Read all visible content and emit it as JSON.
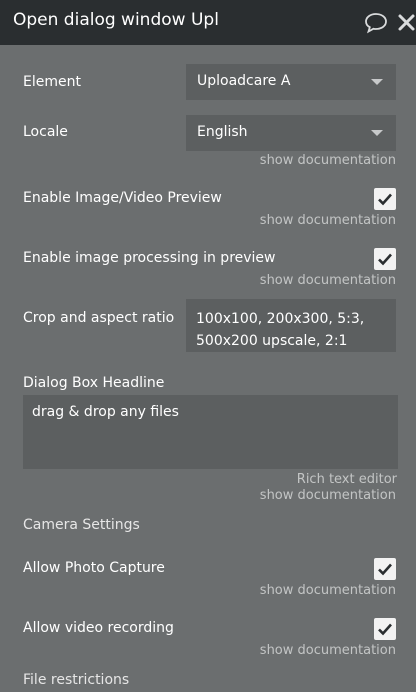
{
  "header": {
    "title": "Open dialog window Upl"
  },
  "fields": {
    "element": {
      "label": "Element",
      "value": "Uploadcare A"
    },
    "locale": {
      "label": "Locale",
      "value": "English",
      "doc": "show documentation"
    },
    "preview": {
      "label": "Enable Image/Video Preview",
      "checked": true,
      "doc": "show documentation"
    },
    "processing": {
      "label": "Enable image processing in preview",
      "checked": true,
      "doc": "show documentation"
    },
    "crop": {
      "label": "Crop and aspect ratio",
      "value": "100x100, 200x300, 5:3, 500x200 upscale, 2:1"
    },
    "headline": {
      "label": "Dialog Box Headline",
      "value": "drag & drop any files",
      "rich": "Rich text editor",
      "doc": "show documentation"
    }
  },
  "camera": {
    "section_label": "Camera Settings",
    "photo": {
      "label": "Allow Photo Capture",
      "checked": true,
      "doc": "show documentation"
    },
    "video": {
      "label": "Allow video recording",
      "checked": true,
      "doc": "show documentation"
    }
  },
  "file_restrictions": {
    "section_label": "File restrictions"
  },
  "colors": {
    "panel_bg": "#6b6e6f",
    "header_bg": "#2a2e30",
    "field_bg": "#5c5f60",
    "checkbox_bg": "#f2f2f2"
  }
}
